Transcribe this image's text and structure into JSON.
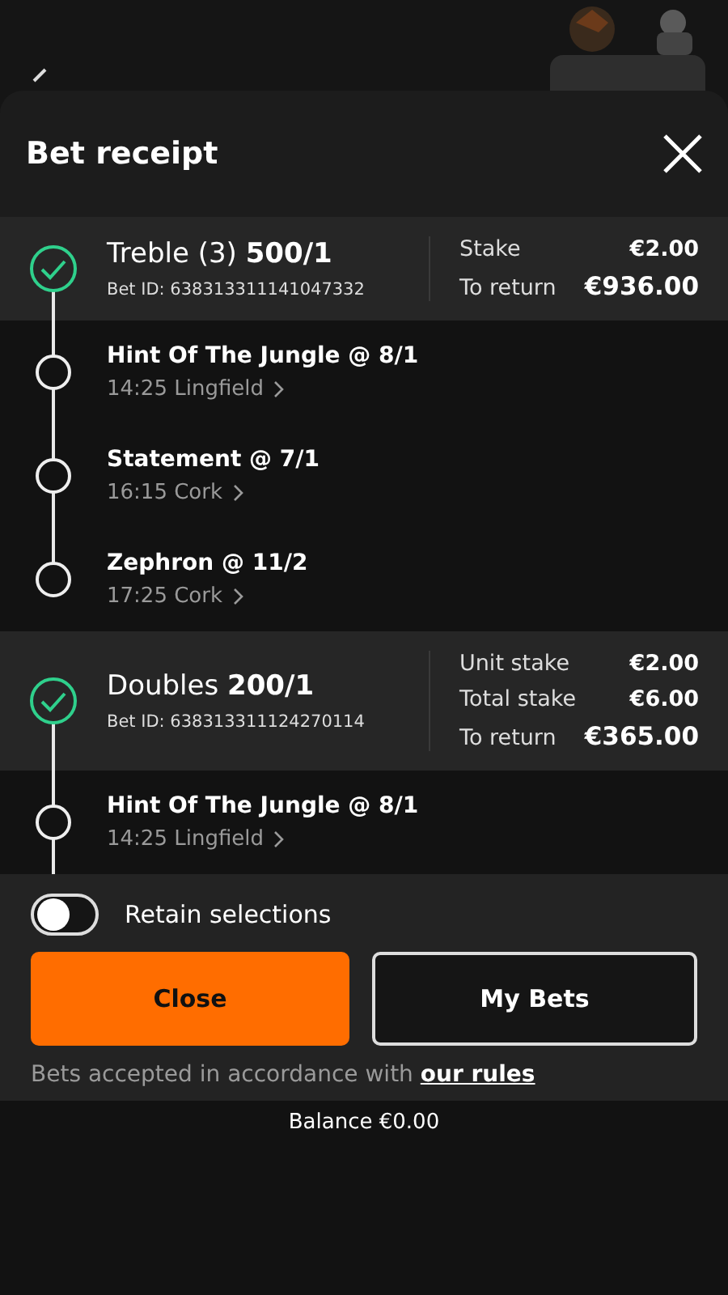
{
  "title": "Bet receipt",
  "bets": [
    {
      "type": "Treble (3)",
      "odds": "500/1",
      "bet_id": "Bet ID: 638313311141047332",
      "amounts": [
        {
          "label": "Stake",
          "value": "€2.00"
        },
        {
          "label": "To return",
          "value": "€936.00"
        }
      ],
      "legs": [
        {
          "selection": "Hint Of The Jungle @ 8/1",
          "event": "14:25 Lingfield"
        },
        {
          "selection": "Statement @ 7/1",
          "event": "16:15 Cork"
        },
        {
          "selection": "Zephron @ 11/2",
          "event": "17:25 Cork"
        }
      ]
    },
    {
      "type": "Doubles",
      "odds": "200/1",
      "bet_id": "Bet ID: 638313311124270114",
      "amounts": [
        {
          "label": "Unit stake",
          "value": "€2.00"
        },
        {
          "label": "Total stake",
          "value": "€6.00"
        },
        {
          "label": "To return",
          "value": "€365.00"
        }
      ],
      "legs": [
        {
          "selection": "Hint Of The Jungle @ 8/1",
          "event": "14:25 Lingfield"
        }
      ]
    }
  ],
  "retain": {
    "label": "Retain selections",
    "on": false
  },
  "buttons": [
    {
      "label": "Close",
      "kind": "primary"
    },
    {
      "label": "My Bets",
      "kind": "secondary"
    }
  ],
  "terms": {
    "text": "Bets accepted in accordance with",
    "link": "our rules"
  },
  "balance": "Balance €0.00"
}
